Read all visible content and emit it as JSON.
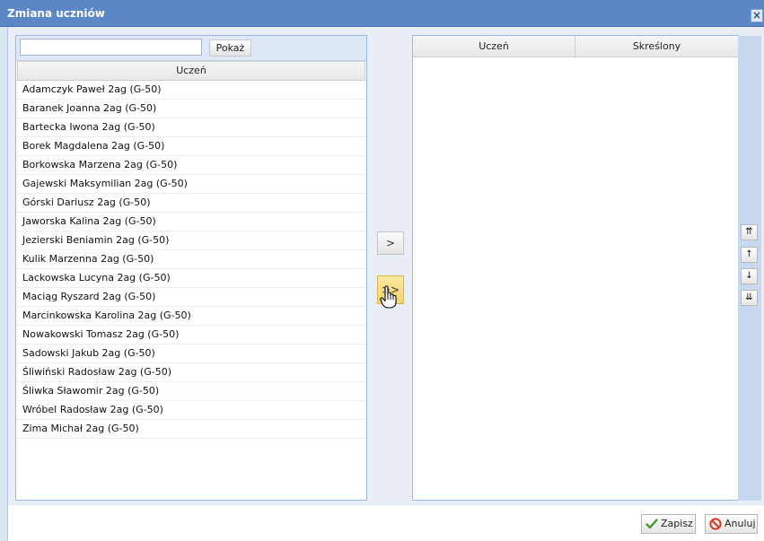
{
  "window": {
    "title": "Zmiana uczniów",
    "close_glyph": "×"
  },
  "left_panel": {
    "search": {
      "value": "",
      "placeholder": ""
    },
    "show_button": "Pokaż",
    "column_header": "Uczeń",
    "students": [
      "Adamczyk Paweł 2ag (G-50)",
      "Baranek Joanna 2ag (G-50)",
      "Bartecka Iwona 2ag (G-50)",
      "Borek Magdalena 2ag (G-50)",
      "Borkowska Marzena 2ag (G-50)",
      "Gajewski Maksymilian 2ag (G-50)",
      "Górski Dariusz 2ag (G-50)",
      "Jaworska Kalina 2ag (G-50)",
      "Jezierski Beniamin 2ag (G-50)",
      "Kulik Marzenna 2ag (G-50)",
      "Lackowska Lucyna 2ag (G-50)",
      "Maciąg Ryszard 2ag (G-50)",
      "Marcinkowska Karolina 2ag (G-50)",
      "Nowakowski Tomasz 2ag (G-50)",
      "Sadowski Jakub 2ag (G-50)",
      "Śliwiński Radosław 2ag (G-50)",
      "Śliwka Sławomir 2ag (G-50)",
      "Wróbel Radosław 2ag (G-50)",
      "Zima Michał 2ag (G-50)"
    ]
  },
  "transfer": {
    "move_one": ">",
    "move_all": ">>"
  },
  "right_panel": {
    "columns": [
      "Uczeń",
      "Skreślony"
    ],
    "rows": []
  },
  "order_buttons": {
    "top": "⇈",
    "up": "↑",
    "down": "↓",
    "bottom": "⇊"
  },
  "footer": {
    "save": "Zapisz",
    "cancel": "Anuluj"
  },
  "icons": {
    "save": "checkmark-icon",
    "cancel": "no-entry-icon",
    "close": "close-icon",
    "cursor": "hand-pointer-icon"
  },
  "colors": {
    "titlebar": "#5b87c6",
    "highlight": "#f3d36a",
    "panel_border": "#99bbe8"
  }
}
